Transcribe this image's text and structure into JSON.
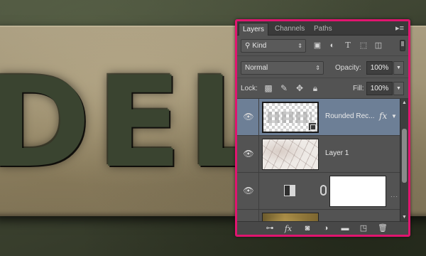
{
  "artwork": {
    "text": "DEL"
  },
  "panel": {
    "tabs": [
      {
        "label": "Layers",
        "active": true
      },
      {
        "label": "Channels",
        "active": false
      },
      {
        "label": "Paths",
        "active": false
      }
    ],
    "menu_icon": "panel-menu-icon",
    "filter": {
      "kind_label": "Kind",
      "icons": [
        "image-filter-icon",
        "adjustment-filter-icon",
        "type-filter-icon",
        "shape-filter-icon",
        "smart-object-filter-icon"
      ]
    },
    "blend_mode": "Normal",
    "opacity_label": "Opacity:",
    "opacity_value": "100%",
    "lock_label": "Lock:",
    "fill_label": "Fill:",
    "fill_value": "100%",
    "layers": [
      {
        "name": "Rounded Rec...",
        "fx": "fx",
        "selected": true
      },
      {
        "name": "Layer 1",
        "selected": false
      },
      {
        "name": "",
        "type": "adjustment-with-mask",
        "selected": false
      },
      {
        "name": "",
        "type": "texture",
        "selected": false
      }
    ],
    "footer_icons": [
      "link-layers-icon",
      "fx-icon",
      "add-mask-icon",
      "adjustment-layer-icon",
      "new-group-icon",
      "new-layer-icon",
      "trash-icon"
    ]
  },
  "colors": {
    "highlight_border": "#e0156f",
    "selected_layer": "#6d7f96",
    "panel_bg": "#535353"
  }
}
